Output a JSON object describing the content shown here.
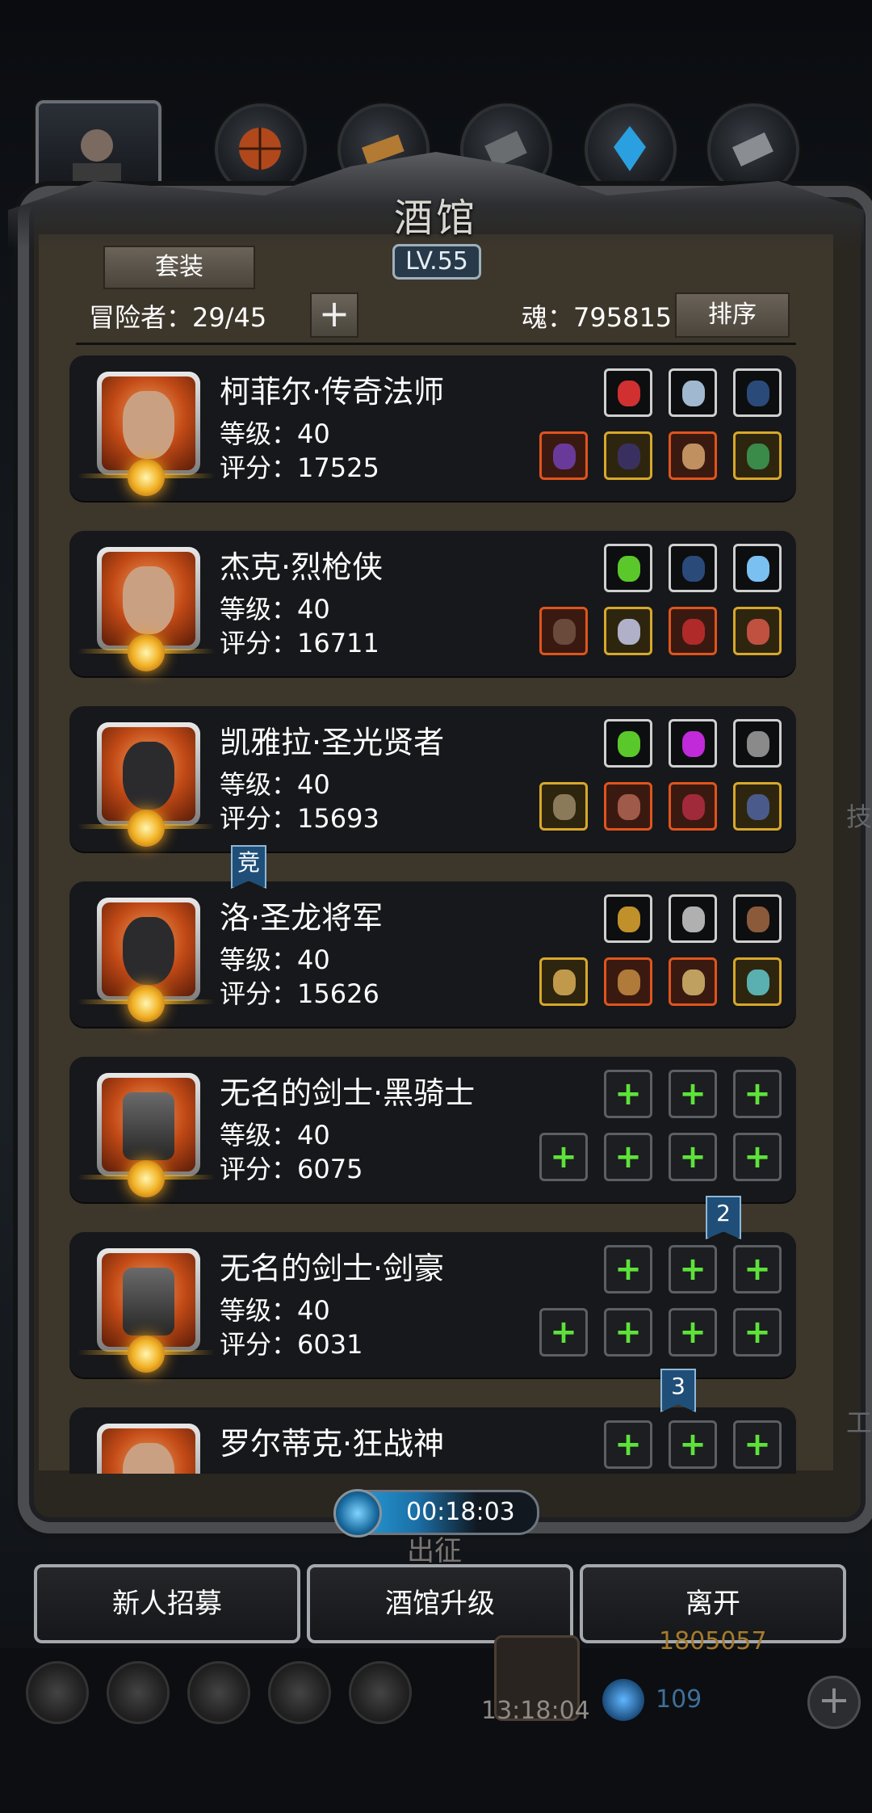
{
  "header": {
    "title": "酒馆",
    "level": "LV.55"
  },
  "toolbar": {
    "set_label": "套装",
    "adventurers_label": "冒险者：29/45",
    "add_symbol": "+",
    "soul_label": "魂：795815",
    "sort_label": "排序"
  },
  "top_tabs": [
    {
      "icon": "portrait-icon"
    },
    {
      "icon": "basketball-icon"
    },
    {
      "icon": "wood-icon"
    },
    {
      "icon": "stone-icon"
    },
    {
      "icon": "crystal-icon"
    },
    {
      "icon": "iron-icon"
    }
  ],
  "heroes": [
    {
      "name": "柯菲尔·传奇法师",
      "level": "等级：40",
      "score": "评分：17525",
      "top_slots": [
        {
          "type": "white",
          "color": "#d03030"
        },
        {
          "type": "white",
          "color": "#a0b8d0"
        },
        {
          "type": "white",
          "color": "#2a4a7a"
        }
      ],
      "bottom_slots": [
        {
          "type": "orange",
          "color": "#6a3a9a"
        },
        {
          "type": "gold",
          "color": "#3a3060"
        },
        {
          "type": "orange",
          "color": "#c09060"
        },
        {
          "type": "gold",
          "color": "#3a8a4a"
        }
      ]
    },
    {
      "name": "杰克·烈枪侠",
      "level": "等级：40",
      "score": "评分：16711",
      "top_slots": [
        {
          "type": "white",
          "color": "#5ac82a"
        },
        {
          "type": "white",
          "color": "#2a4a7a"
        },
        {
          "type": "white",
          "color": "#7ac0f0"
        }
      ],
      "bottom_slots": [
        {
          "type": "orange",
          "color": "#6a4a3a"
        },
        {
          "type": "gold",
          "color": "#b0b0c8"
        },
        {
          "type": "orange",
          "color": "#b02a2a"
        },
        {
          "type": "gold",
          "color": "#c05040"
        }
      ]
    },
    {
      "name": "凯雅拉·圣光贤者",
      "level": "等级：40",
      "score": "评分：15693",
      "top_slots": [
        {
          "type": "white",
          "color": "#5ac82a"
        },
        {
          "type": "white",
          "color": "#c02ad8"
        },
        {
          "type": "white",
          "color": "#8a8a8a"
        }
      ],
      "bottom_slots": [
        {
          "type": "gold",
          "color": "#8a7a5a"
        },
        {
          "type": "orange",
          "color": "#a05a4a"
        },
        {
          "type": "orange",
          "color": "#a02a3a"
        },
        {
          "type": "gold",
          "color": "#4a5a8a"
        }
      ]
    },
    {
      "name": "洛·圣龙将军",
      "level": "等级：40",
      "score": "评分：15626",
      "top_slots": [
        {
          "type": "white",
          "color": "#c0902a"
        },
        {
          "type": "white",
          "color": "#b0b0b0"
        },
        {
          "type": "white",
          "color": "#8a5a3a"
        }
      ],
      "bottom_slots": [
        {
          "type": "gold",
          "color": "#c09a4a"
        },
        {
          "type": "orange",
          "color": "#b07a3a"
        },
        {
          "type": "orange",
          "color": "#c0a060"
        },
        {
          "type": "gold",
          "color": "#5ab0b0"
        }
      ]
    },
    {
      "name": "无名的剑士·黑骑士",
      "level": "等级：40",
      "score": "评分：6075",
      "top_slots": [
        {
          "type": "empty"
        },
        {
          "type": "empty"
        },
        {
          "type": "empty"
        }
      ],
      "bottom_slots": [
        {
          "type": "empty"
        },
        {
          "type": "empty"
        },
        {
          "type": "empty"
        },
        {
          "type": "empty"
        }
      ]
    },
    {
      "name": "无名的剑士·剑豪",
      "level": "等级：40",
      "score": "评分：6031",
      "top_slots": [
        {
          "type": "empty"
        },
        {
          "type": "empty"
        },
        {
          "type": "empty"
        }
      ],
      "bottom_slots": [
        {
          "type": "empty"
        },
        {
          "type": "empty"
        },
        {
          "type": "empty"
        },
        {
          "type": "empty"
        }
      ]
    },
    {
      "name": "罗尔蒂克·狂战神",
      "level": "",
      "score": "",
      "top_slots": [
        {
          "type": "empty"
        },
        {
          "type": "empty"
        },
        {
          "type": "empty"
        }
      ],
      "bottom_slots": []
    }
  ],
  "bookmarks": [
    "竞",
    "2",
    "3"
  ],
  "timer": {
    "value": "00:18:03"
  },
  "ghost": {
    "march_label": "出征",
    "side_char_1": "技",
    "side_char_2": "工"
  },
  "actions": {
    "recruit": "新人招募",
    "upgrade": "酒馆升级",
    "leave": "离开"
  },
  "bottom": {
    "clock": "13:18:04",
    "gold": "1805057",
    "gems": "109",
    "add_symbol": "+",
    "icons": [
      "settings-icon",
      "achievement-icon",
      "shop-icon",
      "mail-icon",
      "puzzle-icon"
    ]
  }
}
